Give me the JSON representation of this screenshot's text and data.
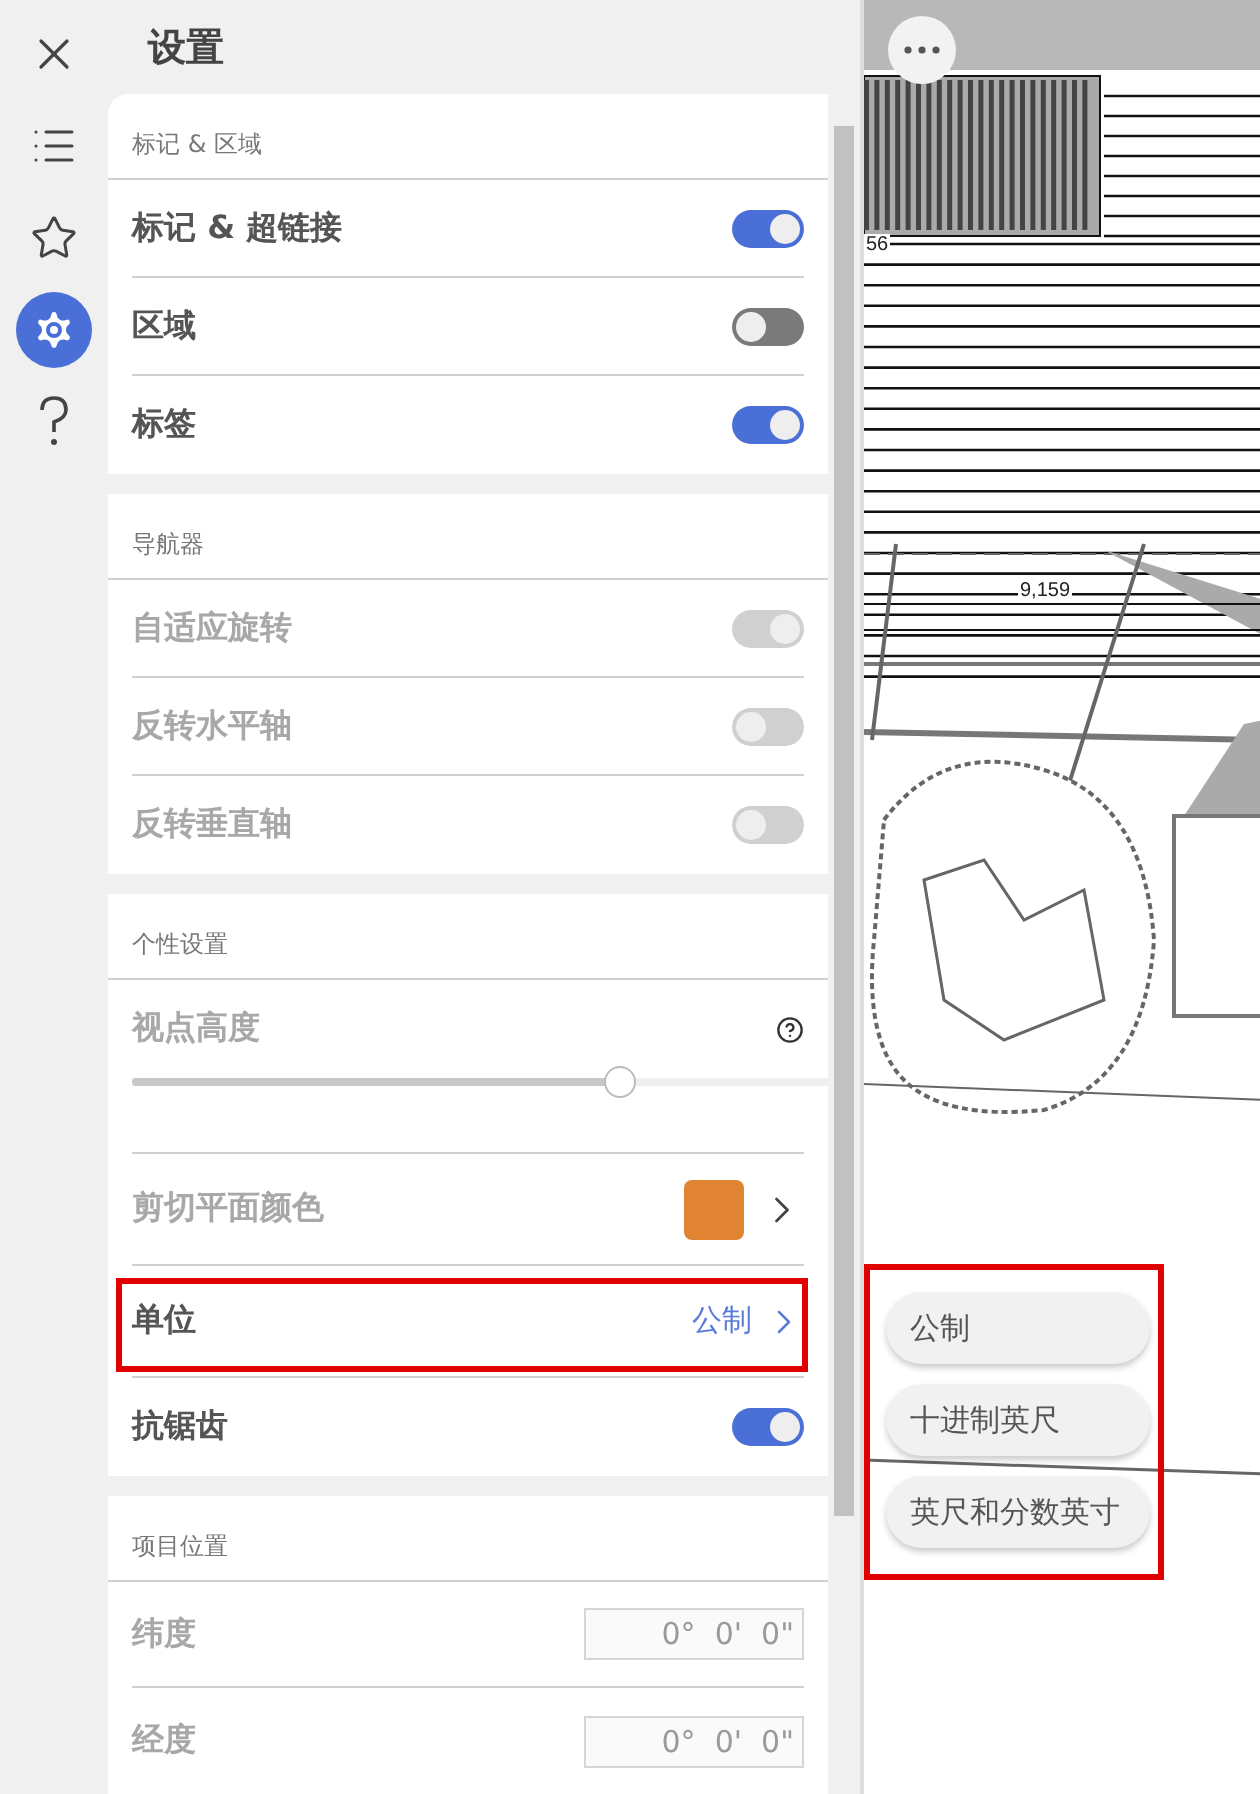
{
  "title": "设置",
  "rail": [
    {
      "kind": "close",
      "selected": false
    },
    {
      "kind": "list",
      "selected": false
    },
    {
      "kind": "star",
      "selected": false
    },
    {
      "kind": "settings",
      "selected": true
    },
    {
      "kind": "help",
      "selected": false
    }
  ],
  "sections": [
    {
      "header": "标记 & 区域",
      "rows": [
        {
          "kind": "toggle",
          "label": "标记 & 超链接",
          "on": true,
          "disabled": false
        },
        {
          "kind": "toggle",
          "label": "区域",
          "on": false,
          "disabled": false
        },
        {
          "kind": "toggle",
          "label": "标签",
          "on": true,
          "disabled": false
        }
      ]
    },
    {
      "header": "导航器",
      "rows": [
        {
          "kind": "toggle",
          "label": "自适应旋转",
          "on": true,
          "disabled": true
        },
        {
          "kind": "toggle",
          "label": "反转水平轴",
          "on": false,
          "disabled": true
        },
        {
          "kind": "toggle",
          "label": "反转垂直轴",
          "on": false,
          "disabled": true
        }
      ]
    },
    {
      "header": "个性设置",
      "rows": [
        {
          "kind": "slider",
          "label": "视点高度",
          "level": 0.7,
          "disabled": true
        },
        {
          "kind": "color",
          "label": "剪切平面颜色",
          "color": "#e08434",
          "disabled": true
        },
        {
          "kind": "link",
          "label": "单位",
          "value": "公制",
          "highlighted": true,
          "disabled": false
        },
        {
          "kind": "toggle",
          "label": "抗锯齿",
          "on": true,
          "disabled": false
        }
      ]
    },
    {
      "header": "项目位置",
      "rows": [
        {
          "kind": "field",
          "label": "纬度",
          "placeholder": "0°  0'  0\"",
          "disabled": true
        },
        {
          "kind": "field",
          "label": "经度",
          "placeholder": "0°  0'  0\"",
          "disabled": true
        }
      ]
    }
  ],
  "drawing": {
    "labels": [
      "56",
      "9,159"
    ]
  },
  "unit_menu": {
    "highlighted": true,
    "options": [
      "公制",
      "十进制英尺",
      "英尺和分数英寸"
    ]
  }
}
